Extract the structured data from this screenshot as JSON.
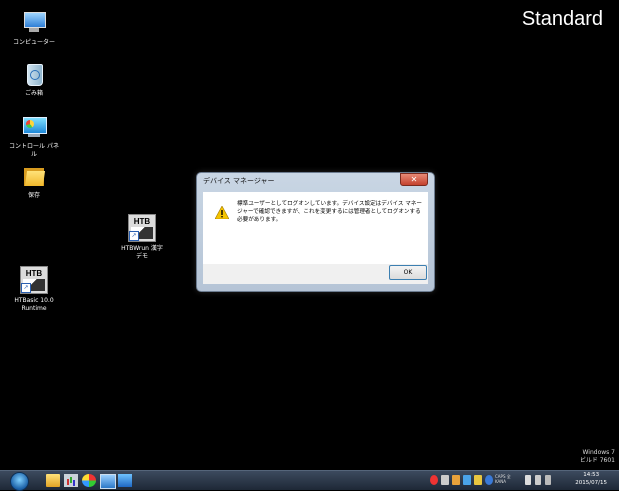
{
  "desktop": {
    "theme_label": "Standard",
    "icons": [
      {
        "label": "コンピューター",
        "icon": "computer-icon"
      },
      {
        "label": "ごみ箱",
        "icon": "recycle-bin-icon"
      },
      {
        "label": "コントロール パネ\nル",
        "icon": "control-panel-icon"
      },
      {
        "label": "保存",
        "icon": "folder-icon"
      },
      {
        "label": "HTBWrun 漢字\nデモ",
        "icon": "htb-shortcut-icon"
      },
      {
        "label": "HTBasic 10.0\nRuntime",
        "icon": "htb-shortcut-icon"
      }
    ],
    "htb_logo_text": "HTB",
    "watermark": {
      "line1": "Windows 7",
      "line2": "ビルド 7601"
    }
  },
  "dialog": {
    "title": "デバイス マネージャー",
    "close_glyph": "✕",
    "message": "標準ユーザーとしてログオンしています。デバイス設定はデバイス マネージャーで確認できますが、これを変更するには管理者としてログオンする必要があります。",
    "ok_label": "OK"
  },
  "taskbar": {
    "tray_text_1": "CAPS 全",
    "tray_text_2": "KANA ",
    "clock_time": "14:53",
    "clock_date": "2015/07/15"
  },
  "colors": {
    "desktop_bg": "#000000",
    "dialog_border": "#6d7d91",
    "taskbar_bg": "#1e2836",
    "ok_border": "#3c7fb1"
  }
}
